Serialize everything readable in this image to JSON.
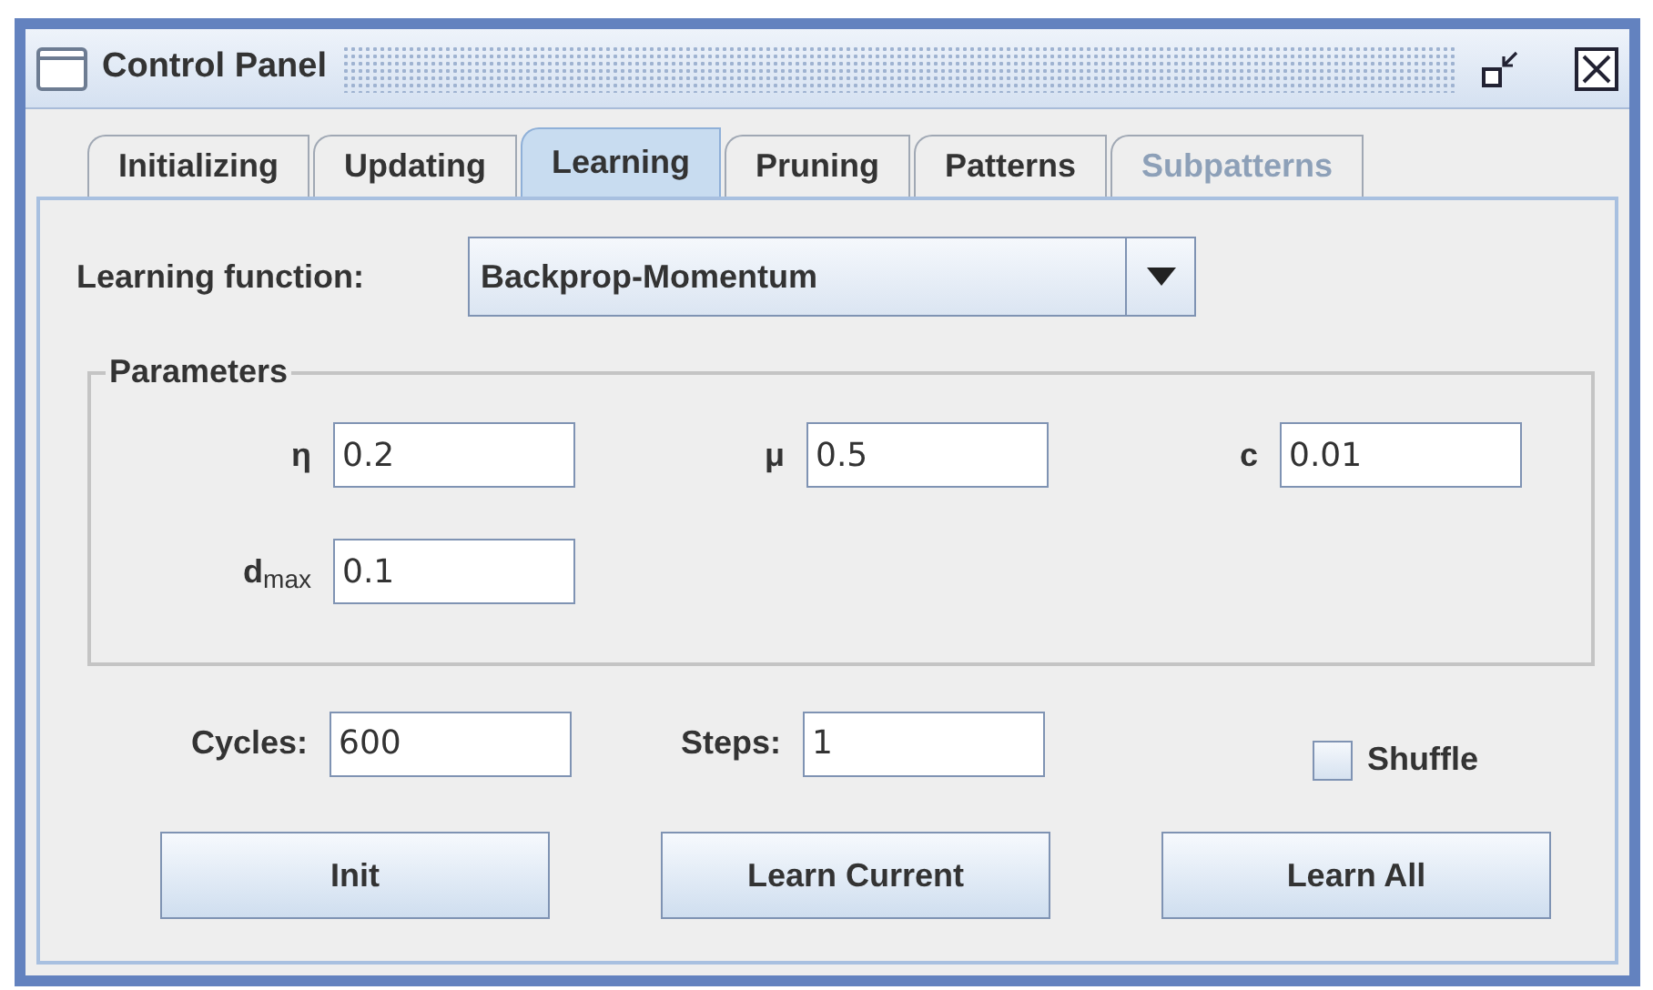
{
  "window": {
    "title": "Control Panel"
  },
  "tabs": [
    {
      "label": "Initializing",
      "selected": false,
      "disabled": false
    },
    {
      "label": "Updating",
      "selected": false,
      "disabled": false
    },
    {
      "label": "Learning",
      "selected": true,
      "disabled": false
    },
    {
      "label": "Pruning",
      "selected": false,
      "disabled": false
    },
    {
      "label": "Patterns",
      "selected": false,
      "disabled": false
    },
    {
      "label": "Subpatterns",
      "selected": false,
      "disabled": true
    }
  ],
  "learning_function": {
    "label": "Learning function:",
    "value": "Backprop-Momentum"
  },
  "parameters": {
    "title": "Parameters",
    "fields": [
      {
        "label": "η",
        "value": "0.2"
      },
      {
        "label": "μ",
        "value": "0.5"
      },
      {
        "label": "c",
        "value": "0.01"
      },
      {
        "label": "d$_{max}$",
        "value": "0.1"
      }
    ]
  },
  "cycles": {
    "label": "Cycles:",
    "value": "600"
  },
  "steps": {
    "label": "Steps:",
    "value": "1"
  },
  "shuffle": {
    "label": "Shuffle",
    "checked": false
  },
  "buttons": [
    "Init",
    "Learn Current",
    "Learn All"
  ]
}
